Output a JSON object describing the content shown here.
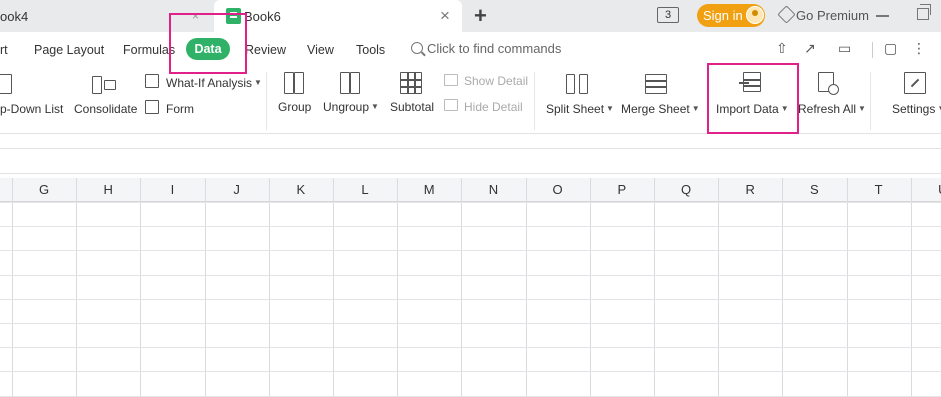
{
  "tabs": {
    "inactive_label": "ook4",
    "inactive_close": "×",
    "active_label": "Book6",
    "active_close": "×",
    "new_tab": "+"
  },
  "titlebar": {
    "tab_count": "3",
    "sign_in": "Sign in",
    "premium": "Go Premium"
  },
  "menu": {
    "items": [
      "rt",
      "Page Layout",
      "Formulas",
      "Data",
      "Review",
      "View",
      "Tools"
    ],
    "find_placeholder": "Click to find commands"
  },
  "ribbon": {
    "dropdown_list": "p-Down List",
    "consolidate": "Consolidate",
    "what_if": "What-If Analysis",
    "form": "Form",
    "group": "Group",
    "ungroup": "Ungroup",
    "subtotal": "Subtotal",
    "show_detail": "Show Detail",
    "hide_detail": "Hide Detail",
    "split_sheet": "Split Sheet",
    "merge_sheet": "Merge Sheet",
    "import_data": "Import Data",
    "refresh_all": "Refresh All",
    "settings": "Settings"
  },
  "columns": [
    "G",
    "H",
    "I",
    "J",
    "K",
    "L",
    "M",
    "N",
    "O",
    "P",
    "Q",
    "R",
    "S",
    "T",
    "U"
  ],
  "colors": {
    "accent_green": "#2fb268",
    "signin_orange": "#f0a010",
    "highlight_pink": "#e0218a"
  },
  "icons": [
    "book-icon",
    "search-icon",
    "avatar",
    "premium-icon",
    "share-icon",
    "export-icon",
    "toolbar-icon",
    "comment-icon",
    "more-icon",
    "minimize-icon",
    "restore-icon"
  ]
}
